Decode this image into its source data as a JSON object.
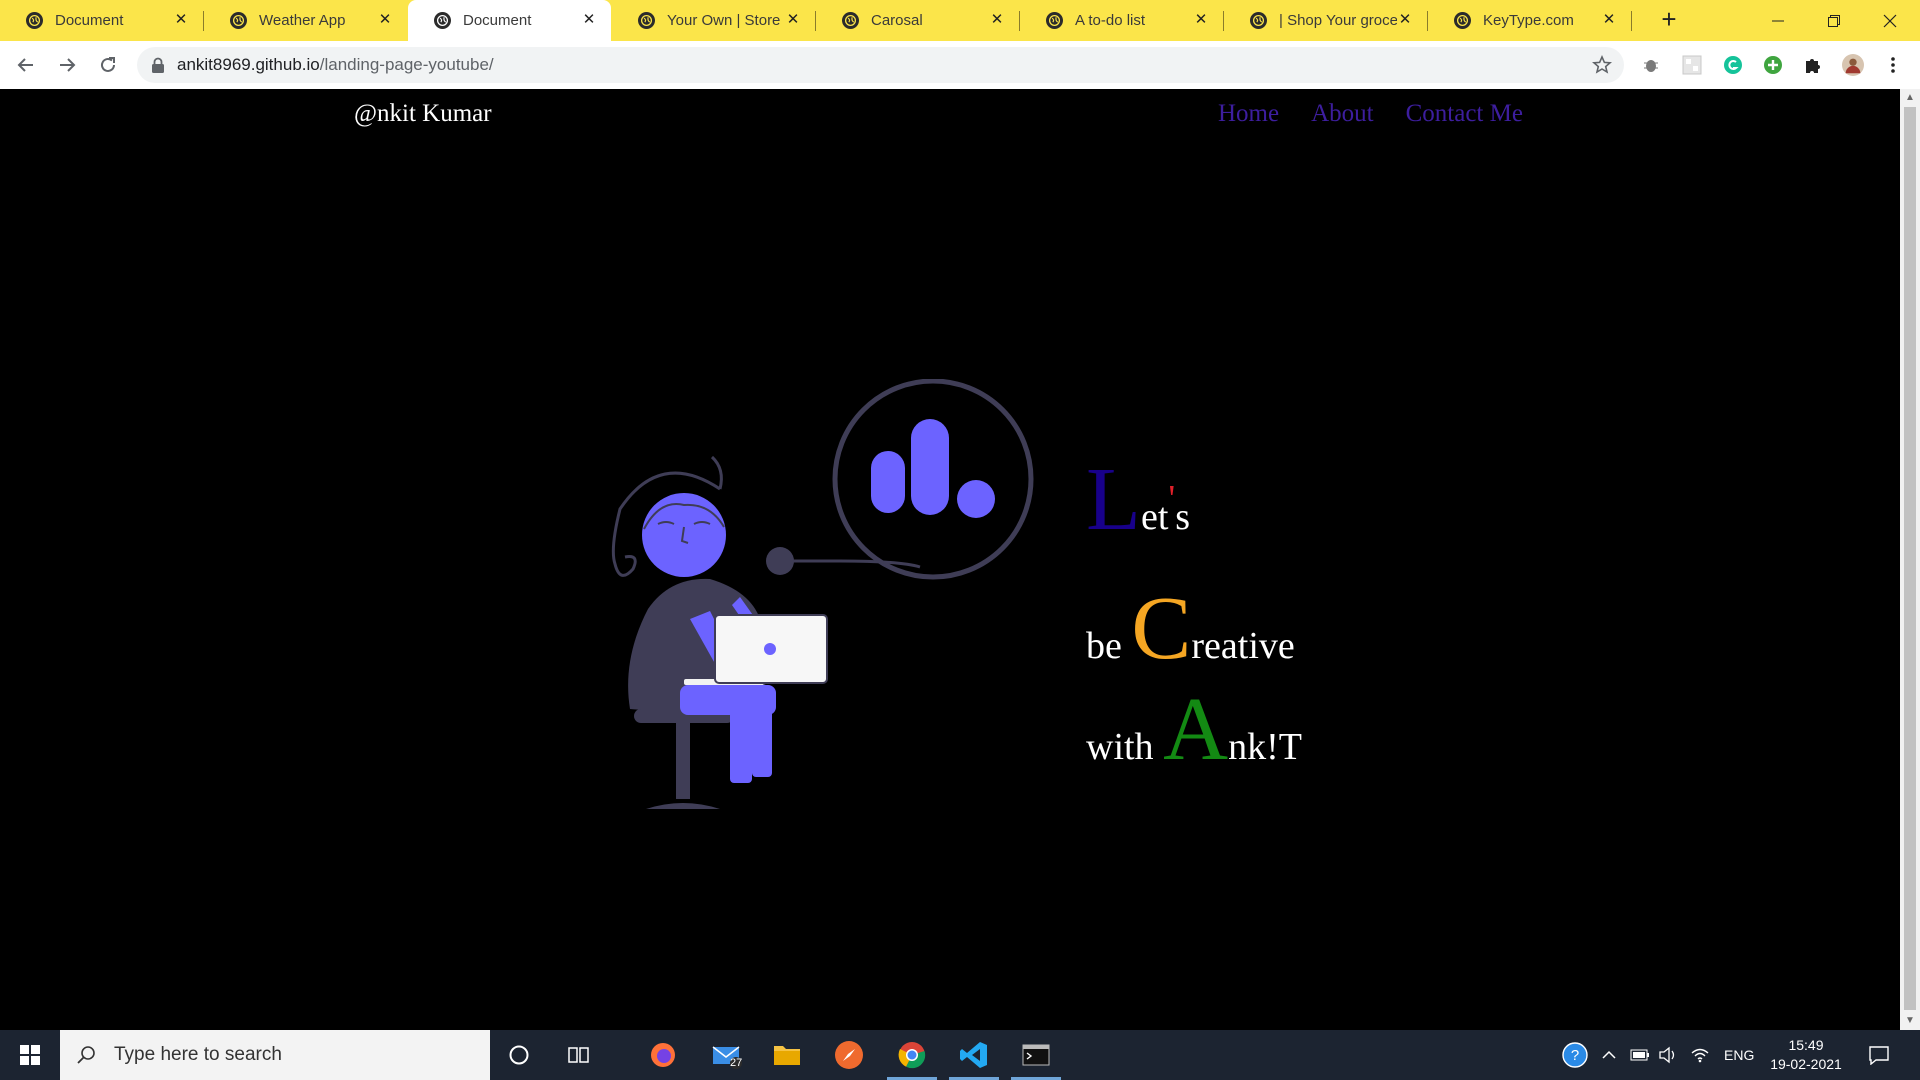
{
  "browser": {
    "tabs": [
      {
        "title": "Document",
        "active": false
      },
      {
        "title": "Weather App",
        "active": false
      },
      {
        "title": "Document",
        "active": true
      },
      {
        "title": "Your Own | Store",
        "active": false
      },
      {
        "title": "Carosal",
        "active": false
      },
      {
        "title": "A to-do list",
        "active": false
      },
      {
        "title": "| Shop Your grocer",
        "active": false
      },
      {
        "title": "KeyType.com",
        "active": false
      }
    ],
    "url_host": "ankit8969.github.io",
    "url_path": "/landing-page-youtube/"
  },
  "site": {
    "brand": "@nkit Kumar",
    "nav": [
      "Home",
      "About",
      "Contact Me"
    ],
    "tagline": {
      "line1": {
        "cap": "L",
        "rest": "et",
        "apos": "'",
        "tail": "s"
      },
      "line2": {
        "pre": "be ",
        "cap": "C",
        "rest": "reative"
      },
      "line3": {
        "pre": "with ",
        "cap": "A",
        "rest": "nk!T"
      }
    }
  },
  "colors": {
    "tab_bar": "#fbe54a",
    "nav_link": "#3d1e9e",
    "cap_L": "#18008a",
    "apostrophe": "#e0202a",
    "cap_C": "#f5a623",
    "cap_A": "#138a13",
    "illustration_accent": "#6c63ff",
    "illustration_dark": "#3f3d56"
  },
  "taskbar": {
    "search_placeholder": "Type here to search",
    "mail_badge": "27",
    "language": "ENG",
    "time": "15:49",
    "date": "19-02-2021"
  }
}
